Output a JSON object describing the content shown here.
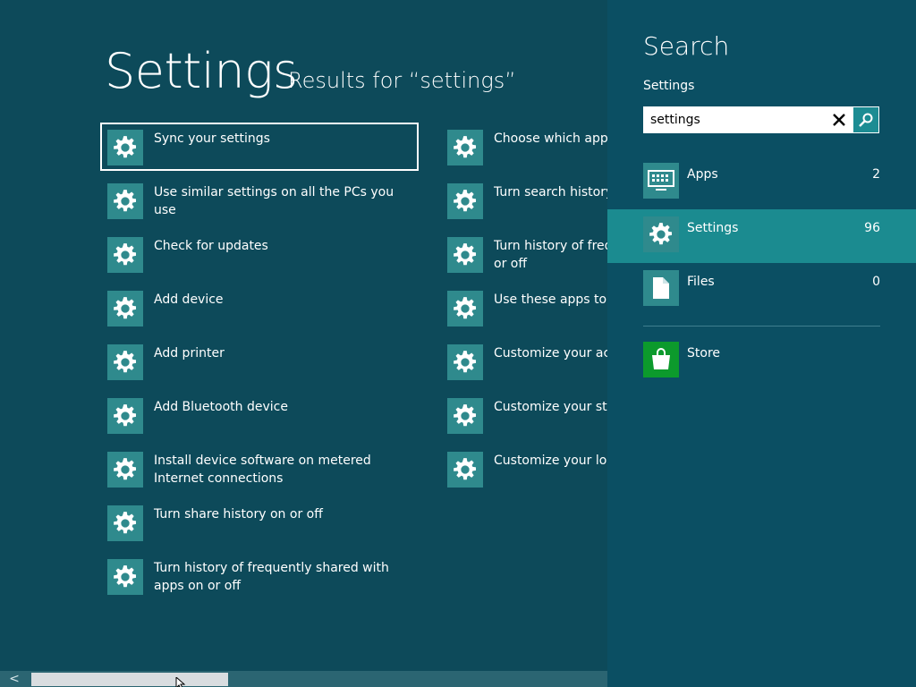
{
  "main": {
    "title": "Settings",
    "subtitle": "Results for “settings”",
    "results_col1": [
      {
        "label": "Sync your settings"
      },
      {
        "label": "Use similar settings on all the PCs you use"
      },
      {
        "label": "Check for updates"
      },
      {
        "label": "Add device"
      },
      {
        "label": "Add printer"
      },
      {
        "label": "Add Bluetooth device"
      },
      {
        "label": "Install device software on metered Internet connections"
      },
      {
        "label": "Turn share history on or off"
      },
      {
        "label": "Turn history of frequently shared with apps on or off"
      }
    ],
    "results_col2": [
      {
        "label": "Choose which apps a"
      },
      {
        "label": "Turn search history o"
      },
      {
        "label": "Turn history of frequ",
        "line2": "or off"
      },
      {
        "label": "Use these apps to se"
      },
      {
        "label": "Customize your acco"
      },
      {
        "label": "Customize your star"
      },
      {
        "label": "Customize your lock"
      }
    ],
    "selected_index": 0,
    "icon": "gear-icon"
  },
  "scrollbar": {
    "left_arrow": "<"
  },
  "charm": {
    "title": "Search",
    "scope": "Settings",
    "search": {
      "value": "settings"
    },
    "categories": [
      {
        "label": "Apps",
        "count": "2",
        "icon": "keyboard-icon"
      },
      {
        "label": "Settings",
        "count": "96",
        "icon": "gear-icon"
      },
      {
        "label": "Files",
        "count": "0",
        "icon": "file-icon"
      }
    ],
    "store": {
      "label": "Store",
      "icon": "shopping-bag-icon"
    }
  },
  "colors": {
    "background": "#0d4a5a",
    "charm_background": "#0b4f63",
    "tile": "#2f8a8d",
    "active_category": "#1b8b90",
    "store_tile": "#0c9a2c"
  }
}
